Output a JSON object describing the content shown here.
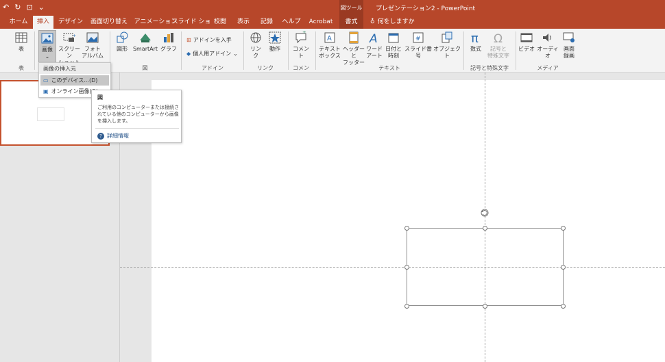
{
  "title_bar": {
    "context_tab_group": "図ツール",
    "window_title": "プレゼンテーション2 - PowerPoint"
  },
  "tabs": [
    "ホーム",
    "挿入",
    "デザイン",
    "画面切り替え",
    "アニメーション",
    "スライド ショー",
    "校閲",
    "表示",
    "記録",
    "ヘルプ",
    "Acrobat",
    "書式"
  ],
  "tell_me": "何をしますか",
  "ribbon": {
    "table_label": "表",
    "table_group": "表",
    "image_label": "画像",
    "screenshot_label_1": "スクリーン",
    "screenshot_label_2": "ショット",
    "photo_album_label_1": "フォト",
    "photo_album_label_2": "アルバム",
    "shapes_label": "図形",
    "smartart_label": "SmartArt",
    "chart_label": "グラフ",
    "illustrations_group": "図",
    "get_addins_label": "アドインを入手",
    "my_addins_label": "個人用アドイン",
    "addins_group": "アドイン",
    "link_label_1": "リン",
    "link_label_2": "ク",
    "action_label": "動作",
    "links_group": "リンク",
    "comment_label": "コメント",
    "comments_group": "コメント",
    "textbox_label_1": "テキスト",
    "textbox_label_2": "ボックス",
    "headerfooter_label_1": "ヘッダーと",
    "headerfooter_label_2": "フッター",
    "wordart_label_1": "ワード",
    "wordart_label_2": "アート",
    "datetime_label_1": "日付と",
    "datetime_label_2": "時刻",
    "slidenumber_label": "スライド番号",
    "object_label": "オブジェクト",
    "text_group": "テキスト",
    "equation_label": "数式",
    "symbol_label_1": "記号と",
    "symbol_label_2": "特殊文字",
    "symbols_group": "記号と特殊文字",
    "video_label": "ビデオ",
    "audio_label": "オーディオ",
    "screenrec_label_1": "画面",
    "screenrec_label_2": "録画",
    "media_group": "メディア"
  },
  "dropdown": {
    "header": "画像の挿入元",
    "items": [
      "このデバイス...(D)",
      "オンライン画像(O)"
    ]
  },
  "tooltip": {
    "title": "図",
    "body": "ご利用のコンピューターまたは接続されている他のコンピューターから画像を挿入します。",
    "link": "詳細情報"
  },
  "colors": {
    "accent": "#b7472a",
    "context_tab": "#9a3a22",
    "ribbon_bg": "#f3f3f3",
    "canvas_bg": "#e6e6e6",
    "link": "#2f5b8f"
  }
}
